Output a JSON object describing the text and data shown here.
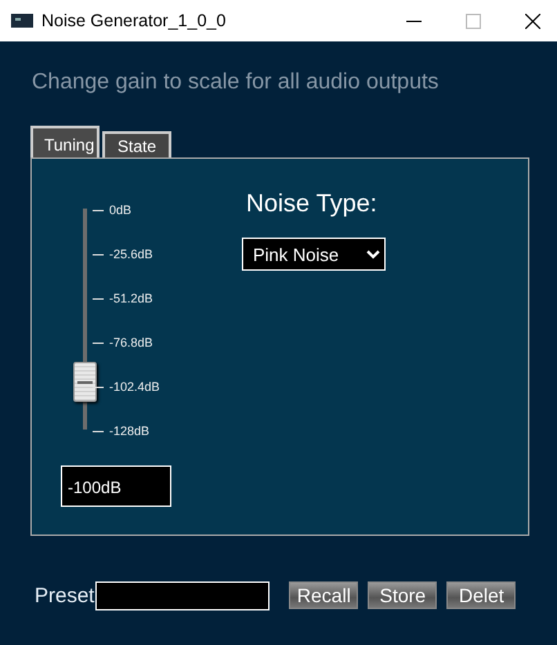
{
  "window": {
    "title": "Noise Generator_1_0_0"
  },
  "heading": "Change gain to scale for all audio outputs",
  "tabs": [
    {
      "label": "Tuning",
      "selected": true
    },
    {
      "label": "State",
      "selected": false
    }
  ],
  "gain_slider": {
    "ticks": [
      "0dB",
      "-25.6dB",
      "-51.2dB",
      "-76.8dB",
      "-102.4dB",
      "-128dB"
    ],
    "level": 0.22
  },
  "gain_value": "-100dB",
  "noise_type": {
    "label": "Noise Type:",
    "value": "Pink Noise"
  },
  "preset": {
    "label": "Preset"
  },
  "buttons": [
    "Recall",
    "Store",
    "Delet"
  ]
}
